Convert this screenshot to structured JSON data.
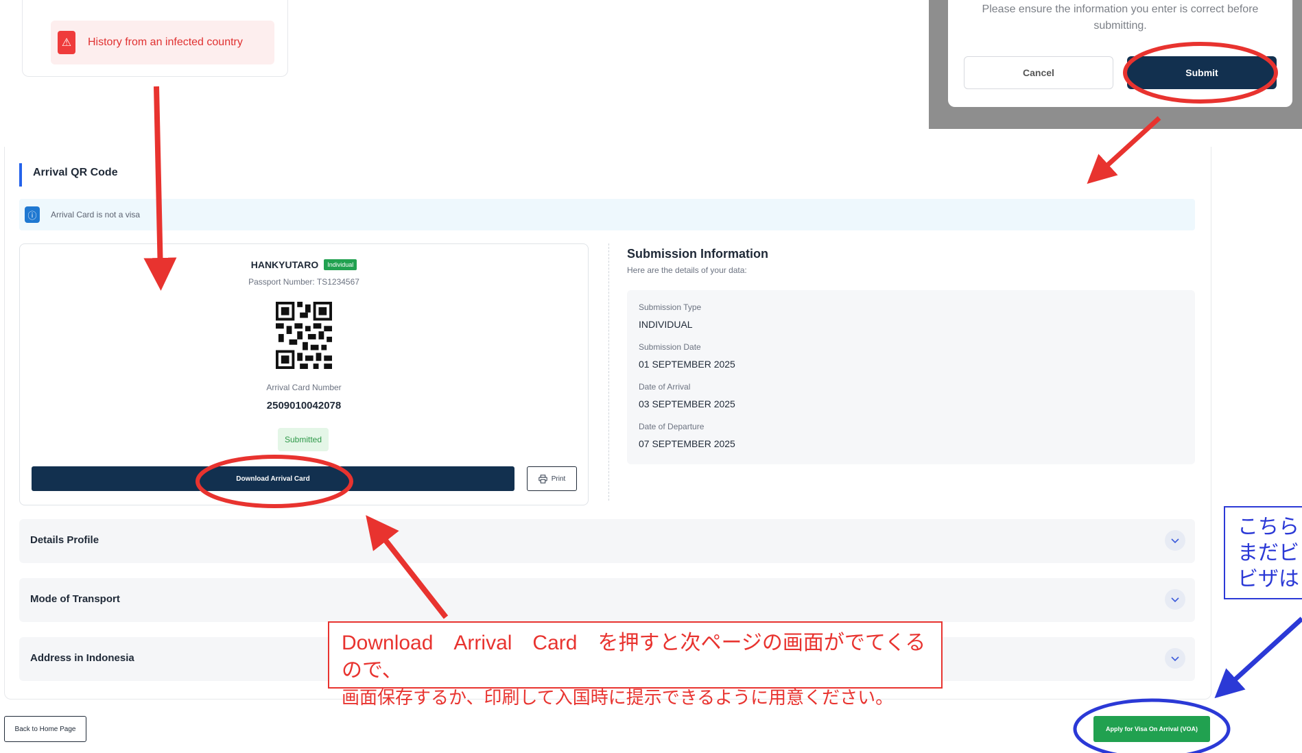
{
  "top_left": {
    "alert_text": "History from an infected country",
    "alert_icon": "warning-icon"
  },
  "modal": {
    "message": "Please ensure the information you enter is correct before submitting.",
    "cancel_label": "Cancel",
    "submit_label": "Submit"
  },
  "arrival": {
    "section_title": "Arrival QR Code",
    "info_text": "Arrival Card is not a visa",
    "info_icon": "info-icon",
    "name": "HANKYUTARO",
    "type_badge": "Individual",
    "passport": "Passport Number: TS1234567",
    "card_number_label": "Arrival Card Number",
    "card_number": "2509010042078",
    "status": "Submitted",
    "download_label": "Download Arrival Card",
    "print_label": "Print"
  },
  "submission": {
    "title": "Submission Information",
    "description": "Here are the details of your data:",
    "fields": [
      {
        "label": "Submission Type",
        "value": "INDIVIDUAL"
      },
      {
        "label": "Submission Date",
        "value": "01 SEPTEMBER 2025"
      },
      {
        "label": "Date of Arrival",
        "value": "03 SEPTEMBER 2025"
      },
      {
        "label": "Date of Departure",
        "value": "07 SEPTEMBER 2025"
      }
    ]
  },
  "accordions": [
    "Details Profile",
    "Mode of Transport",
    "Address in Indonesia"
  ],
  "footer": {
    "back_label": "Back to Home Page",
    "voa_label": "Apply for Visa On Arrival (VOA)"
  },
  "annotations": {
    "red_note_line1": "Download　Arrival　Card　を押すと次ページの画面がでてくるので、",
    "red_note_line2": "画面保存するか、印刷して入国時に提示できるように用意ください。",
    "blue_note_lines": [
      "こちら",
      "まだビ",
      "ビザは"
    ]
  },
  "colors": {
    "navy": "#12304f",
    "green": "#21a150",
    "annotation_red": "#e8332f",
    "annotation_blue": "#2b39d6",
    "accent_blue": "#2563eb"
  }
}
